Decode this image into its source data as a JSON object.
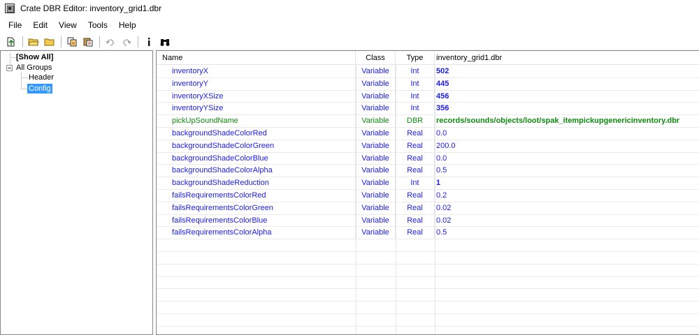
{
  "window": {
    "title": "Crate DBR Editor: inventory_grid1.dbr"
  },
  "menu": [
    "File",
    "Edit",
    "View",
    "Tools",
    "Help"
  ],
  "toolbar": {
    "buttons": [
      "open-record-icon",
      "open-folder-icon",
      "new-folder-icon",
      "copy-icon",
      "paste-icon",
      "undo-icon",
      "redo-icon",
      "info-icon",
      "find-icon"
    ]
  },
  "tree": {
    "show_all": "[Show All]",
    "all_groups": "All Groups",
    "header": "Header",
    "config": "Config"
  },
  "grid": {
    "columns": {
      "name": "Name",
      "class": "Class",
      "type": "Type",
      "file": "inventory_grid1.dbr"
    },
    "rows": [
      {
        "name": "inventoryX",
        "class": "Variable",
        "type": "Int",
        "value": "502",
        "color": "#1a1aee",
        "bold": true
      },
      {
        "name": "inventoryY",
        "class": "Variable",
        "type": "Int",
        "value": "445",
        "color": "#1a1aee",
        "bold": true
      },
      {
        "name": "inventoryXSize",
        "class": "Variable",
        "type": "Int",
        "value": "456",
        "color": "#1a1aee",
        "bold": true
      },
      {
        "name": "inventoryYSize",
        "class": "Variable",
        "type": "Int",
        "value": "356",
        "color": "#1a1aee",
        "bold": true
      },
      {
        "name": "pickUpSoundName",
        "class": "Variable",
        "type": "DBR",
        "value": "records/sounds/objects/loot/spak_itempickupgenericinventory.dbr",
        "color": "#108a10",
        "bold": true
      },
      {
        "name": "backgroundShadeColorRed",
        "class": "Variable",
        "type": "Real",
        "value": "0.0",
        "color": "#1a1aee",
        "bold": false
      },
      {
        "name": "backgroundShadeColorGreen",
        "class": "Variable",
        "type": "Real",
        "value": "200.0",
        "color": "#1a1aee",
        "bold": false
      },
      {
        "name": "backgroundShadeColorBlue",
        "class": "Variable",
        "type": "Real",
        "value": "0.0",
        "color": "#1a1aee",
        "bold": false
      },
      {
        "name": "backgroundShadeColorAlpha",
        "class": "Variable",
        "type": "Real",
        "value": "0.5",
        "color": "#1a1aee",
        "bold": false
      },
      {
        "name": "backgroundShadeReduction",
        "class": "Variable",
        "type": "Int",
        "value": "1",
        "color": "#1a1aee",
        "bold": true
      },
      {
        "name": "failsRequirementsColorRed",
        "class": "Variable",
        "type": "Real",
        "value": "0.2",
        "color": "#1a1aee",
        "bold": false
      },
      {
        "name": "failsRequirementsColorGreen",
        "class": "Variable",
        "type": "Real",
        "value": "0.02",
        "color": "#1a1aee",
        "bold": false
      },
      {
        "name": "failsRequirementsColorBlue",
        "class": "Variable",
        "type": "Real",
        "value": "0.02",
        "color": "#1a1aee",
        "bold": false
      },
      {
        "name": "failsRequirementsColorAlpha",
        "class": "Variable",
        "type": "Real",
        "value": "0.5",
        "color": "#1a1aee",
        "bold": false
      }
    ]
  },
  "colors": {
    "selection": "#3399ff",
    "default_name": "#1a1aee",
    "dbr_name": "#108a10"
  }
}
